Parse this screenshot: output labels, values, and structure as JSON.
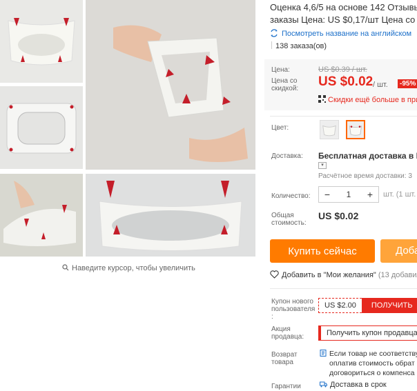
{
  "gallery": {
    "zoom_hint": "Наведите курсор, чтобы увеличить"
  },
  "product": {
    "title_line1": "Оценка 4,6/5 на основе 142 Отзывы",
    "title_line2": "заказы Цена: US $0,17/шт Цена со ск",
    "translate_link": "Посмотреть название на английском",
    "orders": "138 заказа(ов)"
  },
  "price": {
    "label": "Цена:",
    "old": "US $0.39 / шт.",
    "discount_label": "Цена со скидкой:",
    "new": "US $0.02",
    "per_unit": "/ шт.",
    "discount_badge": "-95%",
    "cheaper_link": "Скидки ещё больше в при"
  },
  "options": {
    "color_label": "Цвет:",
    "selected_index": 1
  },
  "shipping": {
    "label": "Доставка:",
    "title": "Бесплатная доставка в Russ",
    "eta": "Расчётное время доставки: 3"
  },
  "quantity": {
    "label": "Количество:",
    "minus": "−",
    "value": "1",
    "plus": "+",
    "note": "шт. (1 шт. е"
  },
  "total": {
    "label": "Общая стоимость:",
    "value": "US $0.02"
  },
  "actions": {
    "buy_now": "Купить сейчас",
    "add_to_cart": "Доба",
    "wishlist": "Добавить в \"Мои желания\"",
    "wishlist_count": "(13 добавил"
  },
  "coupons": {
    "new_user_label": "Купон нового пользователя :",
    "new_user_amount": "US $2.00",
    "get_button": "ПОЛУЧИТЬ",
    "seller_promo_label": "Акция продавца:",
    "seller_coupon": "Получить купон продавца"
  },
  "returns": {
    "label": "Возврат товара",
    "line1": "Если товар не соответству",
    "line2": "оплатив стоимость обрат",
    "line3": "договориться о компенса"
  },
  "guarantee": {
    "label": "Гарантии",
    "value": "Доставка в срок"
  },
  "colors": {
    "accent": "#ff7b00",
    "price_red": "#e6281e",
    "link_blue": "#1b6fc9"
  }
}
